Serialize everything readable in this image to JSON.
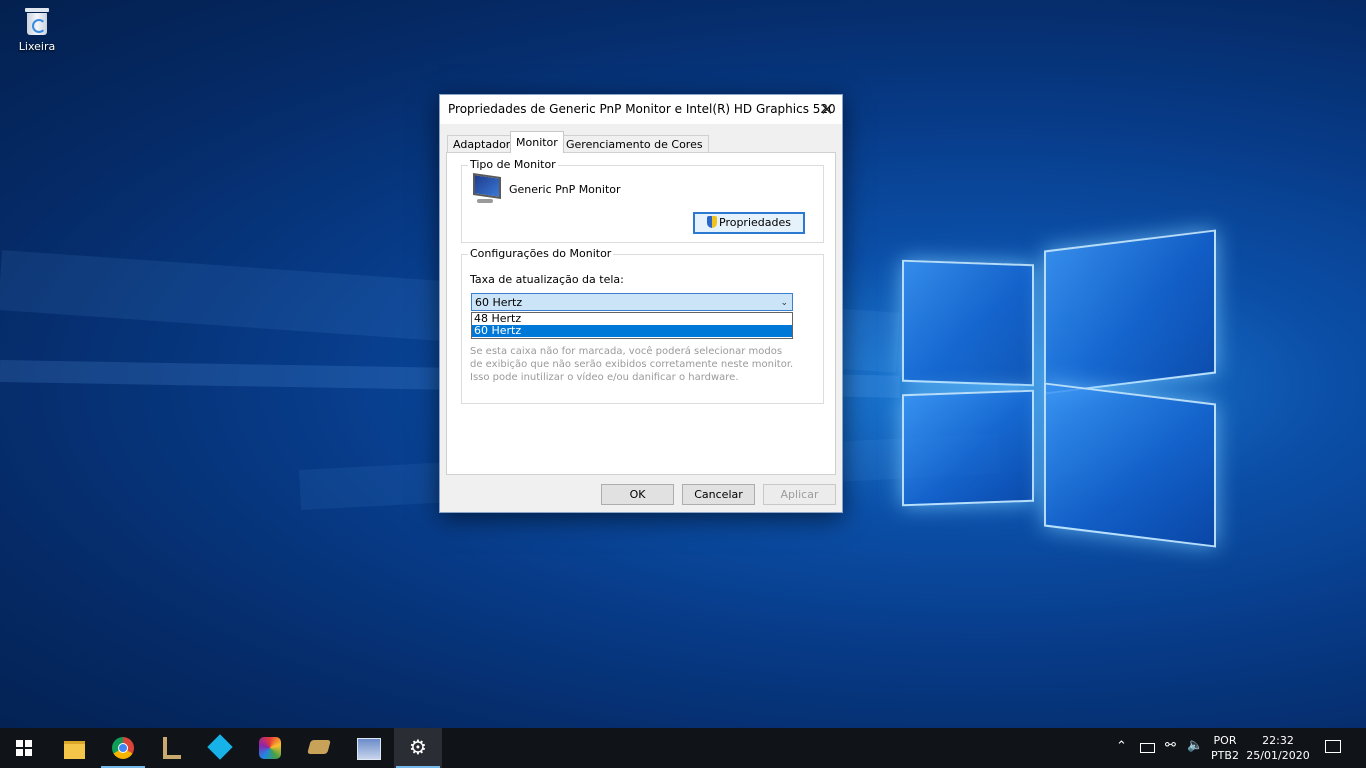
{
  "desktop": {
    "recycle_bin_label": "Lixeira"
  },
  "dialog": {
    "title": "Propriedades de Generic PnP Monitor e Intel(R) HD Graphics 520",
    "close_glyph": "✕",
    "tabs": [
      {
        "label": "Adaptador",
        "active": false
      },
      {
        "label": "Monitor",
        "active": true
      },
      {
        "label": "Gerenciamento de Cores",
        "active": false
      }
    ],
    "monitor_type": {
      "group_label": "Tipo de Monitor",
      "monitor_name": "Generic PnP Monitor",
      "properties_button": "Propriedades"
    },
    "monitor_settings": {
      "group_label": "Configurações do Monitor",
      "refresh_label": "Taxa de atualização da tela:",
      "refresh_selected": "60 Hertz",
      "refresh_options": [
        "48 Hertz",
        "60 Hertz"
      ],
      "highlighted_option": "60 Hertz",
      "hint_text": "Se esta caixa não for marcada, você poderá selecionar modos de exibição que não serão exibidos corretamente neste monitor. Isso pode inutilizar o vídeo e/ou danificar o hardware."
    },
    "buttons": {
      "ok": "OK",
      "cancel": "Cancelar",
      "apply": "Aplicar",
      "apply_enabled": false
    }
  },
  "taskbar": {
    "apps": [
      {
        "icon": "windows-start-icon"
      },
      {
        "icon": "file-explorer-icon",
        "running": false
      },
      {
        "icon": "chrome-icon",
        "running": true
      },
      {
        "icon": "league-of-legends-icon",
        "running": false
      },
      {
        "icon": "kodi-icon",
        "running": false
      },
      {
        "icon": "colorful-pentagon-app-icon",
        "running": false
      },
      {
        "icon": "disk-drive-app-icon",
        "running": false
      },
      {
        "icon": "car-game-icon",
        "running": false
      },
      {
        "icon": "settings-gear-icon",
        "running": true,
        "active": true
      }
    ],
    "tray": {
      "language_top": "POR",
      "language_bottom": "PTB2",
      "time": "22:32",
      "date": "25/01/2020"
    }
  },
  "colors": {
    "accent": "#0078d7",
    "taskbar_bg": "#101318",
    "running_indicator": "#76b9ed"
  }
}
